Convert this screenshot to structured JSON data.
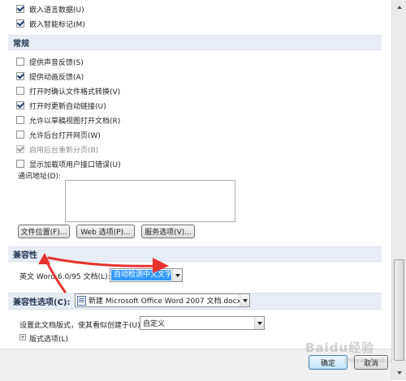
{
  "top_checkboxes": [
    {
      "label": "嵌入语言数据(U)",
      "checked": true
    },
    {
      "label": "嵌入智能标记(M)",
      "checked": true
    }
  ],
  "general": {
    "header": "常规",
    "checkboxes": [
      {
        "label": "提供声音反馈(S)",
        "checked": false,
        "disabled": false
      },
      {
        "label": "提供动画反馈(A)",
        "checked": true,
        "disabled": false
      },
      {
        "label": "打开时确认文件格式转换(V)",
        "checked": false,
        "disabled": false
      },
      {
        "label": "打开时更新自动链接(U)",
        "checked": true,
        "disabled": false
      },
      {
        "label": "允许以草稿视图打开文档(R)",
        "checked": false,
        "disabled": false
      },
      {
        "label": "允许后台打开网页(W)",
        "checked": false,
        "disabled": false
      },
      {
        "label": "启用后台重新分页(B)",
        "checked": true,
        "disabled": true
      },
      {
        "label": "显示加载项用户接口错误(U)",
        "checked": false,
        "disabled": false
      }
    ],
    "mailing_address_label": "通讯地址(D):",
    "mailing_address_value": "",
    "buttons": {
      "file_locations": "文件位置(F)...",
      "web_options": "Web 选项(P)...",
      "service_options": "服务选项(V)..."
    }
  },
  "compatibility": {
    "header": "兼容性",
    "word6_label": "英文 Word 6.0/95 文档(L):",
    "word6_value": "自动检测中文文字"
  },
  "compat_options": {
    "header": "兼容性选项(C):",
    "document_value": "新建 Microsoft Office Word 2007 文档.docx",
    "layout_label": "设置此文档版式，使其看似创建于(U):",
    "layout_value": "自定义",
    "layout_options_label": "版式选项(L)",
    "expander_glyph": "+"
  },
  "footer": {
    "ok": "确定",
    "cancel": "取消"
  },
  "watermark": {
    "main": "Baidu经验",
    "sub": "jingyan.baidu.com"
  },
  "icons": {
    "expander": "plus-expander-icon",
    "document": "word-document-icon",
    "dropdown": "chevron-down-icon",
    "scroll_up": "scroll-up-icon",
    "scroll_down": "scroll-down-icon"
  },
  "colors": {
    "section_header_bg": "#e8edf5",
    "highlight": "#3399ff",
    "annotation_arrow": "#e8322f"
  }
}
